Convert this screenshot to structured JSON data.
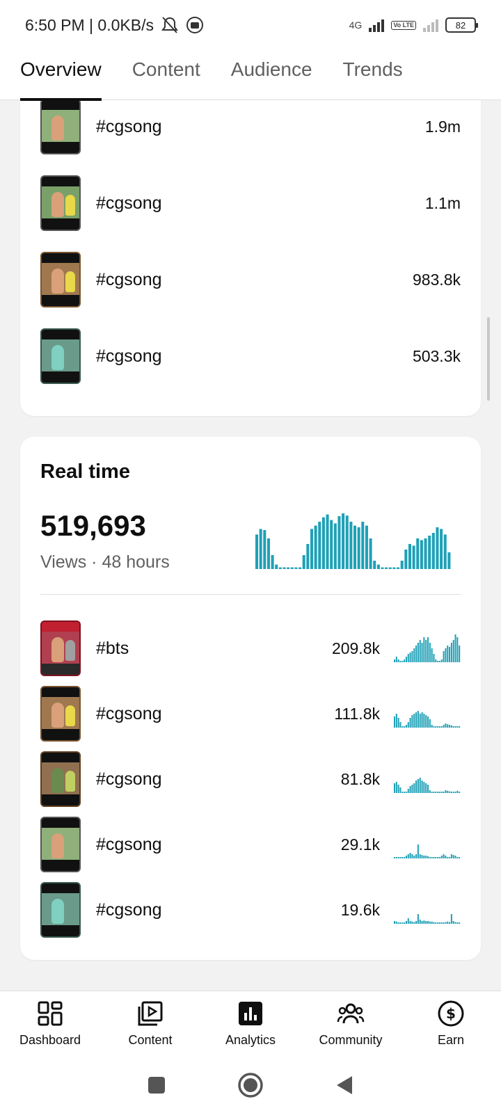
{
  "status": {
    "time_speed": "6:50 PM | 0.0KB/s",
    "network": "4G",
    "volte": "Vo LTE",
    "battery": "82"
  },
  "tabs": [
    {
      "label": "Overview",
      "active": true
    },
    {
      "label": "Content",
      "active": false
    },
    {
      "label": "Audience",
      "active": false
    },
    {
      "label": "Trends",
      "active": false
    }
  ],
  "top_content": {
    "items": [
      {
        "title": "#cgsong",
        "value": "1.9m"
      },
      {
        "title": "#cgsong",
        "value": "1.1m"
      },
      {
        "title": "#cgsong",
        "value": "983.8k"
      },
      {
        "title": "#cgsong",
        "value": "503.3k"
      }
    ]
  },
  "realtime": {
    "title": "Real time",
    "count": "519,693",
    "subtitle": "Views · 48 hours",
    "accent_color": "#1fa0b6",
    "bars": [
      0.62,
      0.72,
      0.7,
      0.55,
      0.25,
      0.08,
      0.03,
      0.03,
      0.03,
      0.03,
      0.03,
      0.03,
      0.25,
      0.45,
      0.72,
      0.78,
      0.85,
      0.93,
      0.98,
      0.88,
      0.82,
      0.95,
      1.0,
      0.96,
      0.85,
      0.78,
      0.75,
      0.85,
      0.78,
      0.55,
      0.15,
      0.08,
      0.03,
      0.03,
      0.03,
      0.03,
      0.03,
      0.15,
      0.35,
      0.45,
      0.42,
      0.55,
      0.52,
      0.55,
      0.6,
      0.65,
      0.75,
      0.72,
      0.62,
      0.3
    ],
    "items": [
      {
        "title": "#bts",
        "value": "209.8k",
        "thumb_text": "subscribe",
        "spark": [
          0.1,
          0.2,
          0.1,
          0.05,
          0.05,
          0.1,
          0.2,
          0.3,
          0.35,
          0.4,
          0.5,
          0.6,
          0.7,
          0.8,
          0.7,
          0.9,
          0.8,
          0.9,
          0.7,
          0.5,
          0.3,
          0.1,
          0.05,
          0.05,
          0.1,
          0.4,
          0.5,
          0.6,
          0.55,
          0.7,
          0.8,
          1.0,
          0.9,
          0.6
        ]
      },
      {
        "title": "#cgsong",
        "value": "111.8k",
        "spark": [
          0.4,
          0.5,
          0.35,
          0.2,
          0.05,
          0.05,
          0.1,
          0.2,
          0.35,
          0.45,
          0.5,
          0.55,
          0.6,
          0.5,
          0.55,
          0.5,
          0.45,
          0.4,
          0.3,
          0.1,
          0.05,
          0.05,
          0.05,
          0.05,
          0.05,
          0.1,
          0.15,
          0.12,
          0.1,
          0.08,
          0.05,
          0.05,
          0.05,
          0.05
        ]
      },
      {
        "title": "#cgsong",
        "value": "81.8k",
        "spark": [
          0.35,
          0.4,
          0.3,
          0.2,
          0.05,
          0.05,
          0.05,
          0.15,
          0.25,
          0.3,
          0.35,
          0.45,
          0.5,
          0.55,
          0.45,
          0.4,
          0.35,
          0.3,
          0.1,
          0.05,
          0.05,
          0.05,
          0.05,
          0.05,
          0.05,
          0.05,
          0.1,
          0.08,
          0.06,
          0.05,
          0.05,
          0.05,
          0.08,
          0.05
        ]
      },
      {
        "title": "#cgsong",
        "value": "29.1k",
        "spark": [
          0.05,
          0.05,
          0.05,
          0.05,
          0.05,
          0.05,
          0.1,
          0.15,
          0.2,
          0.15,
          0.1,
          0.15,
          0.5,
          0.15,
          0.12,
          0.1,
          0.1,
          0.08,
          0.05,
          0.05,
          0.05,
          0.05,
          0.05,
          0.05,
          0.1,
          0.15,
          0.1,
          0.05,
          0.05,
          0.15,
          0.12,
          0.1,
          0.05,
          0.05
        ]
      },
      {
        "title": "#cgsong",
        "value": "19.6k",
        "spark": [
          0.1,
          0.08,
          0.05,
          0.05,
          0.05,
          0.05,
          0.1,
          0.2,
          0.1,
          0.08,
          0.06,
          0.1,
          0.35,
          0.15,
          0.1,
          0.12,
          0.1,
          0.1,
          0.08,
          0.08,
          0.06,
          0.05,
          0.05,
          0.05,
          0.05,
          0.05,
          0.06,
          0.08,
          0.06,
          0.35,
          0.1,
          0.06,
          0.05,
          0.05
        ]
      }
    ]
  },
  "bottom_nav": [
    {
      "label": "Dashboard",
      "icon": "dashboard-icon"
    },
    {
      "label": "Content",
      "icon": "content-icon"
    },
    {
      "label": "Analytics",
      "icon": "analytics-icon",
      "active": true
    },
    {
      "label": "Community",
      "icon": "community-icon"
    },
    {
      "label": "Earn",
      "icon": "earn-icon"
    }
  ]
}
